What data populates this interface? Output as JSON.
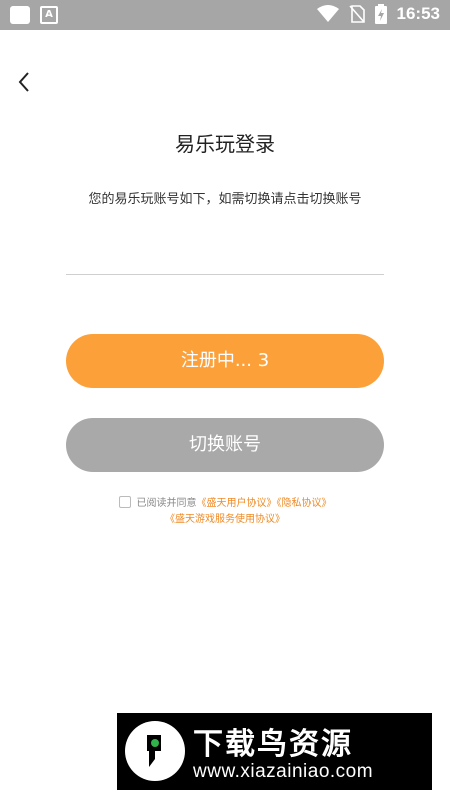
{
  "status_bar": {
    "time": "16:53",
    "icons": [
      "app-square-icon",
      "a-notification-icon",
      "wifi-icon",
      "no-sim-icon",
      "battery-charging-icon"
    ]
  },
  "header": {
    "back_icon": "chevron-left-icon",
    "title": "易乐玩登录",
    "subtitle": "您的易乐玩账号如下，如需切换请点击切换账号"
  },
  "account_input": {
    "value": "",
    "placeholder": ""
  },
  "buttons": {
    "register_label": "注册中... 3",
    "switch_label": "切换账号"
  },
  "agreement": {
    "prefix": "已阅读并同意",
    "user_agreement": "《盛天用户协议》",
    "privacy": "《隐私协议》",
    "service": "《盛天游戏服务使用协议》"
  },
  "watermark": {
    "title": "下载鸟资源",
    "url": "www.xiazainiao.com"
  },
  "colors": {
    "status_bar": "#a6a6a6",
    "primary": "#fca03a",
    "disabled": "#a9a9a9",
    "link": "#f08a24"
  }
}
